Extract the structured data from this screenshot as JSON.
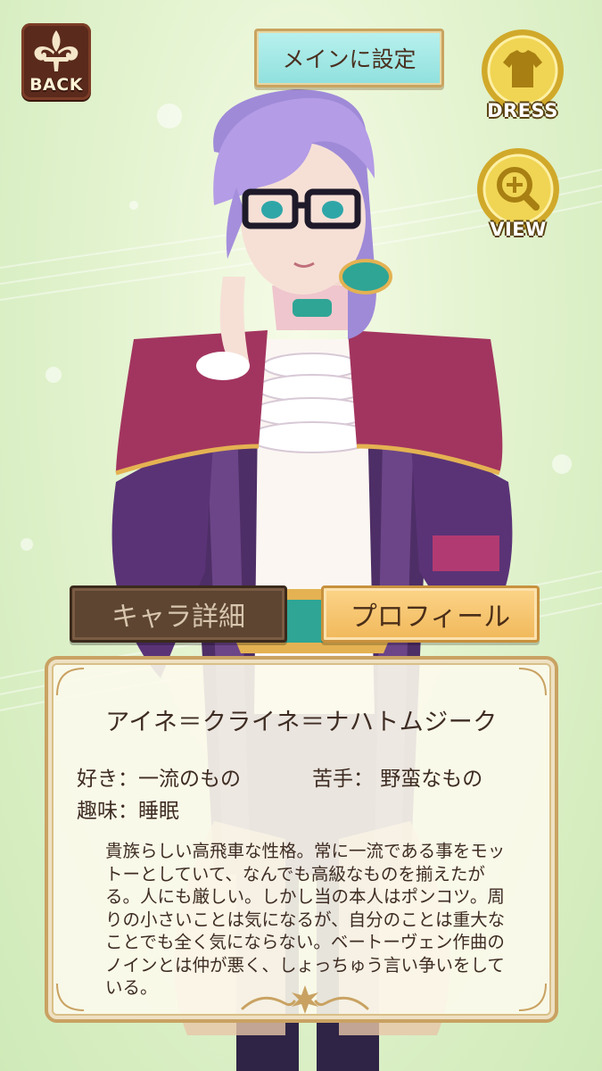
{
  "header": {
    "back_label": "BACK",
    "set_main_label": "メインに設定",
    "dress_label": "DRESS",
    "view_label": "VIEW"
  },
  "tabs": [
    {
      "label": "キャラ詳細",
      "active": false
    },
    {
      "label": "プロフィール",
      "active": true
    }
  ],
  "profile": {
    "name": "アイネ＝クライネ＝ナハトムジーク",
    "likes": "好き：一流のもの",
    "dislikes": "苦手：  野蛮なもの",
    "hobby": "趣味：睡眠",
    "description": "貴族らしい高飛車な性格。常に一流である事をモットーとしていて、なんでも高級なものを揃えたがる。人にも厳しい。しかし当の本人はポンコツ。周りの小さいことは気になるが、自分のことは重大なことでも全く気にならない。ベートーヴェン作曲のノインとは仲が悪く、しょっちゅう言い争いをしている。"
  },
  "icons": {
    "back": "fleur-de-lis-icon",
    "dress": "tshirt-icon",
    "view": "magnifier-plus-icon",
    "ornament": "star-ornament-icon"
  },
  "colors": {
    "background": "#dff1cc",
    "back_button": "#5a2a1c",
    "set_main_button": "#9fe6e3",
    "gold": "#d6b13a",
    "tab_inactive": "#5d4532",
    "tab_active": "#f5c26a",
    "panel_border": "#c9a262",
    "text": "#3e2c22"
  }
}
